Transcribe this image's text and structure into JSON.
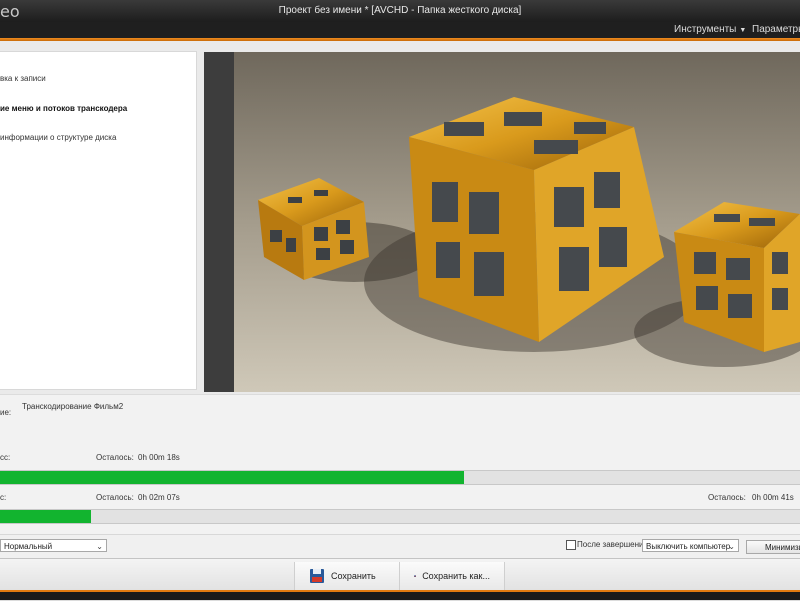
{
  "window": {
    "app_name_fragment": "eo",
    "title": "Проект без имени * [AVCHD - Папка жесткого диска]"
  },
  "menu": {
    "tools": "Инструменты",
    "params": "Параметры"
  },
  "steps": [
    {
      "label": "вка к записи",
      "active": false
    },
    {
      "label": "ие меню и потоков транскодера",
      "active": true
    },
    {
      "label": "информации о структуре диска",
      "active": false
    }
  ],
  "progress": {
    "action_label": "ие:",
    "action_value": "Транскодирование Фильм2",
    "current_label": "сс:",
    "current_remaining_label": "Осталось:",
    "current_remaining_value": "0h 00m 18s",
    "current_percent": 58,
    "total_label": "с:",
    "total_remaining_label": "Осталось:",
    "total_remaining_value": "0h 02m 07s",
    "total_remaining2_label": "Осталось:",
    "total_remaining2_value": "0h 00m 41s",
    "total_percent": 11.4
  },
  "controls": {
    "priority_value": "Нормальный",
    "after_finish_label": "После завершения",
    "after_finish_value": "Выключить компьютер",
    "minimize_label": "Минимизи"
  },
  "bottom": {
    "save_label": "Сохранить",
    "save_as_label": "Сохранить как..."
  },
  "colors": {
    "accent_orange": "#f08c20",
    "progress_green": "#12b42f"
  }
}
